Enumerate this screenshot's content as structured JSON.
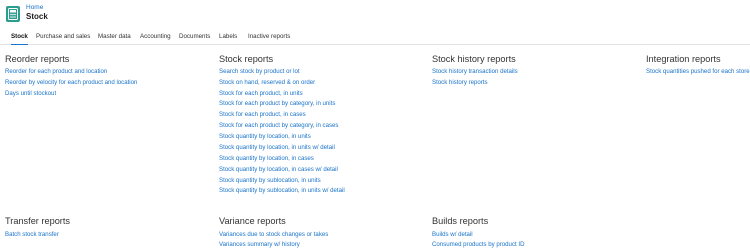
{
  "header": {
    "breadcrumb": "Home",
    "title": "Stock",
    "icon": "calculator-icon",
    "accent": "#2a9d8f"
  },
  "tabs": [
    {
      "label": "Stock",
      "active": true
    },
    {
      "label": "Purchase and sales"
    },
    {
      "label": "Master data"
    },
    {
      "label": "Accounting"
    },
    {
      "label": "Documents"
    },
    {
      "label": "Labels"
    },
    {
      "label": "Inactive reports"
    }
  ],
  "sections": {
    "reorder": {
      "title": "Reorder reports",
      "links": [
        "Reorder for each product and location",
        "Reorder by velocity for each product and location",
        "Days until stockout"
      ]
    },
    "stock": {
      "title": "Stock reports",
      "links": [
        "Search stock by product or lot",
        "Stock on hand, reserved & on order",
        "Stock for each product, in units",
        "Stock for each product by category, in units",
        "Stock for each product, in cases",
        "Stock for each product by category, in cases",
        "Stock quantity by location, in units",
        "Stock quantity by location, in units w/ detail",
        "Stock quantity by location, in cases",
        "Stock quantity by location, in cases w/ detail",
        "Stock quantity by sublocation, in units",
        "Stock quantity by sublocation, in units w/ detail"
      ]
    },
    "history": {
      "title": "Stock history reports",
      "links": [
        "Stock history transaction details",
        "Stock history reports"
      ]
    },
    "integration": {
      "title": "Integration reports",
      "links": [
        "Stock quantities pushed for each store"
      ]
    },
    "transfer": {
      "title": "Transfer reports",
      "links": [
        "Batch stock transfer"
      ]
    },
    "variance": {
      "title": "Variance reports",
      "links": [
        "Variances due to stock changes or takes",
        "Variances summary w/ history"
      ]
    },
    "builds": {
      "title": "Builds reports",
      "links": [
        "Builds w/ detail",
        "Consumed products by product ID"
      ]
    }
  },
  "colors": {
    "link": "#1a73c9",
    "text": "#222222"
  }
}
